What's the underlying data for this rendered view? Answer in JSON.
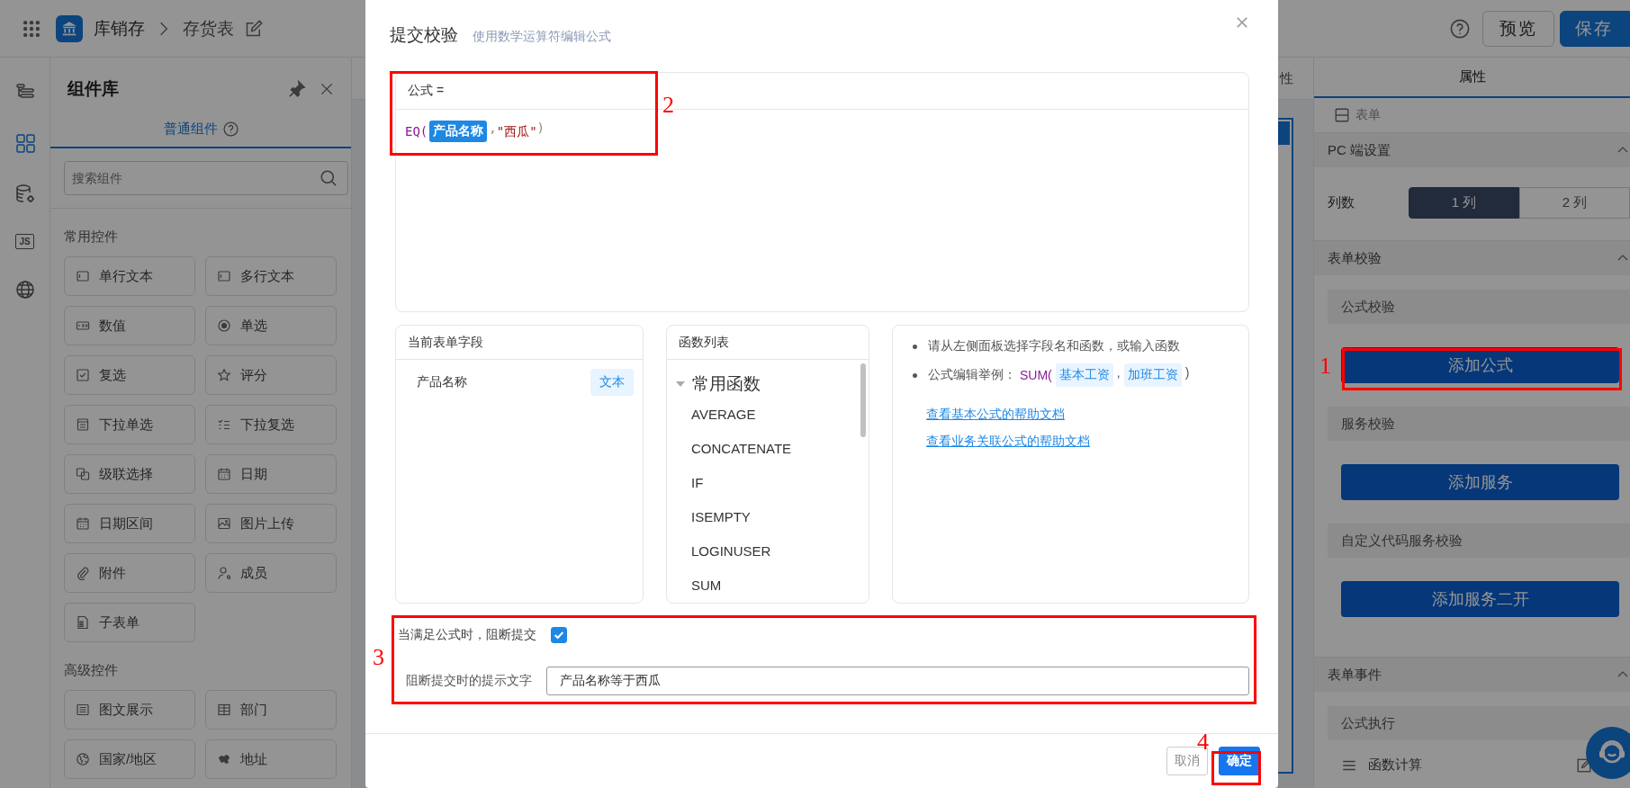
{
  "top_bar": {
    "app_name": "库销存",
    "page_name": "存货表",
    "buttons": [
      {
        "label": "预览",
        "kind": "secondary"
      },
      {
        "label": "保存",
        "kind": "primary"
      }
    ]
  },
  "left_rail": {
    "items": [
      {
        "kind": "outline",
        "selected": false
      },
      {
        "kind": "components",
        "selected": true
      },
      {
        "kind": "database",
        "selected": false
      },
      {
        "kind": "script",
        "label": "JS",
        "selected": false
      },
      {
        "kind": "globe",
        "selected": false
      }
    ]
  },
  "component_panel": {
    "title": "组件库",
    "tabs": [
      {
        "label": "普通组件",
        "selected": true
      }
    ],
    "search": {
      "placeholder": "搜索组件"
    },
    "groups": [
      {
        "title": "常用控件",
        "items": [
          {
            "label": "单行文本",
            "kind": "text"
          },
          {
            "label": "多行文本",
            "kind": "textarea"
          },
          {
            "label": "数值",
            "kind": "number"
          },
          {
            "label": "单选",
            "kind": "radio"
          },
          {
            "label": "复选",
            "kind": "checkbox"
          },
          {
            "label": "评分",
            "kind": "star"
          },
          {
            "label": "下拉单选",
            "kind": "select"
          },
          {
            "label": "下拉复选",
            "kind": "multiselect"
          },
          {
            "label": "级联选择",
            "kind": "cascade"
          },
          {
            "label": "日期",
            "kind": "date"
          },
          {
            "label": "日期区间",
            "kind": "date"
          },
          {
            "label": "图片上传",
            "kind": "image"
          },
          {
            "label": "附件",
            "kind": "attachment"
          },
          {
            "label": "成员",
            "kind": "member"
          },
          {
            "label": "子表单",
            "kind": "subform"
          }
        ]
      },
      {
        "title": "高级控件",
        "items": [
          {
            "label": "图文展示",
            "kind": "richtext"
          },
          {
            "label": "部门",
            "kind": "department"
          },
          {
            "label": "国家/地区",
            "kind": "country"
          },
          {
            "label": "地址",
            "kind": "address"
          }
        ]
      }
    ]
  },
  "canvas": {
    "tab_fragment": "性"
  },
  "property_panel": {
    "tabs": [
      {
        "label": "属性",
        "selected": true
      }
    ],
    "form_label": "表单",
    "sections": [
      {
        "title": "PC 端设置",
        "expanded": true,
        "kind": "columns",
        "label": "列数",
        "options": [
          {
            "label": "1 列",
            "selected": true
          },
          {
            "label": "2 列",
            "selected": false
          }
        ]
      },
      {
        "title": "表单校验",
        "expanded": true,
        "kind": "groups",
        "groups": [
          {
            "title": "公式校验",
            "button": "添加公式"
          },
          {
            "title": "服务校验",
            "button": "添加服务"
          },
          {
            "title": "自定义代码服务校验",
            "button": "添加服务二开"
          }
        ]
      },
      {
        "title": "表单事件",
        "expanded": true,
        "kind": "groups",
        "groups": [
          {
            "title": "公式执行",
            "rows": [
              {
                "label": "函数计算"
              }
            ]
          }
        ]
      }
    ]
  },
  "modal": {
    "title": "提交校验",
    "subtitle": "使用数学运算符编辑公式",
    "formula": {
      "header": "公式 =",
      "tokens": [
        {
          "kind": "func",
          "text": "EQ("
        },
        {
          "kind": "field",
          "text": "产品名称"
        },
        {
          "kind": "punct",
          "text": ","
        },
        {
          "kind": "string",
          "text": "\"西瓜\""
        },
        {
          "kind": "punct",
          "text": ")"
        }
      ]
    },
    "fields_panel": {
      "title": "当前表单字段",
      "fields": [
        {
          "name": "产品名称",
          "type": "文本"
        }
      ]
    },
    "functions_panel": {
      "title": "函数列表",
      "groups": [
        {
          "title": "常用函数",
          "expanded": true,
          "children": [
            {
              "name": "AVERAGE"
            },
            {
              "name": "CONCATENATE"
            },
            {
              "name": "IF"
            },
            {
              "name": "ISEMPTY"
            },
            {
              "name": "LOGINUSER"
            },
            {
              "name": "SUM"
            }
          ]
        }
      ]
    },
    "help": {
      "bullets": [
        {
          "tokens": [
            {
              "kind": "text",
              "text": "请从左侧面板选择字段名和函数，或输入函数"
            }
          ]
        },
        {
          "tokens": [
            {
              "kind": "text",
              "text": "公式编辑举例："
            },
            {
              "kind": "func",
              "text": "SUM("
            },
            {
              "kind": "field",
              "text": "基本工资"
            },
            {
              "kind": "punct",
              "text": ","
            },
            {
              "kind": "field",
              "text": "加班工资"
            },
            {
              "kind": "punct",
              "text": ")"
            }
          ]
        }
      ],
      "links": [
        "查看基本公式的帮助文档",
        "查看业务关联公式的帮助文档"
      ]
    },
    "block_option": {
      "label": "当满足公式时，阻断提交",
      "checked": true
    },
    "message_field": {
      "label": "阻断提交时的提示文字",
      "value": "产品名称等于西瓜"
    },
    "buttons": [
      {
        "label": "取消",
        "kind": "secondary"
      },
      {
        "label": "确定",
        "kind": "primary"
      }
    ]
  },
  "annotations": [
    {
      "label": "1"
    },
    {
      "label": "2"
    },
    {
      "label": "3"
    },
    {
      "label": "4"
    }
  ]
}
